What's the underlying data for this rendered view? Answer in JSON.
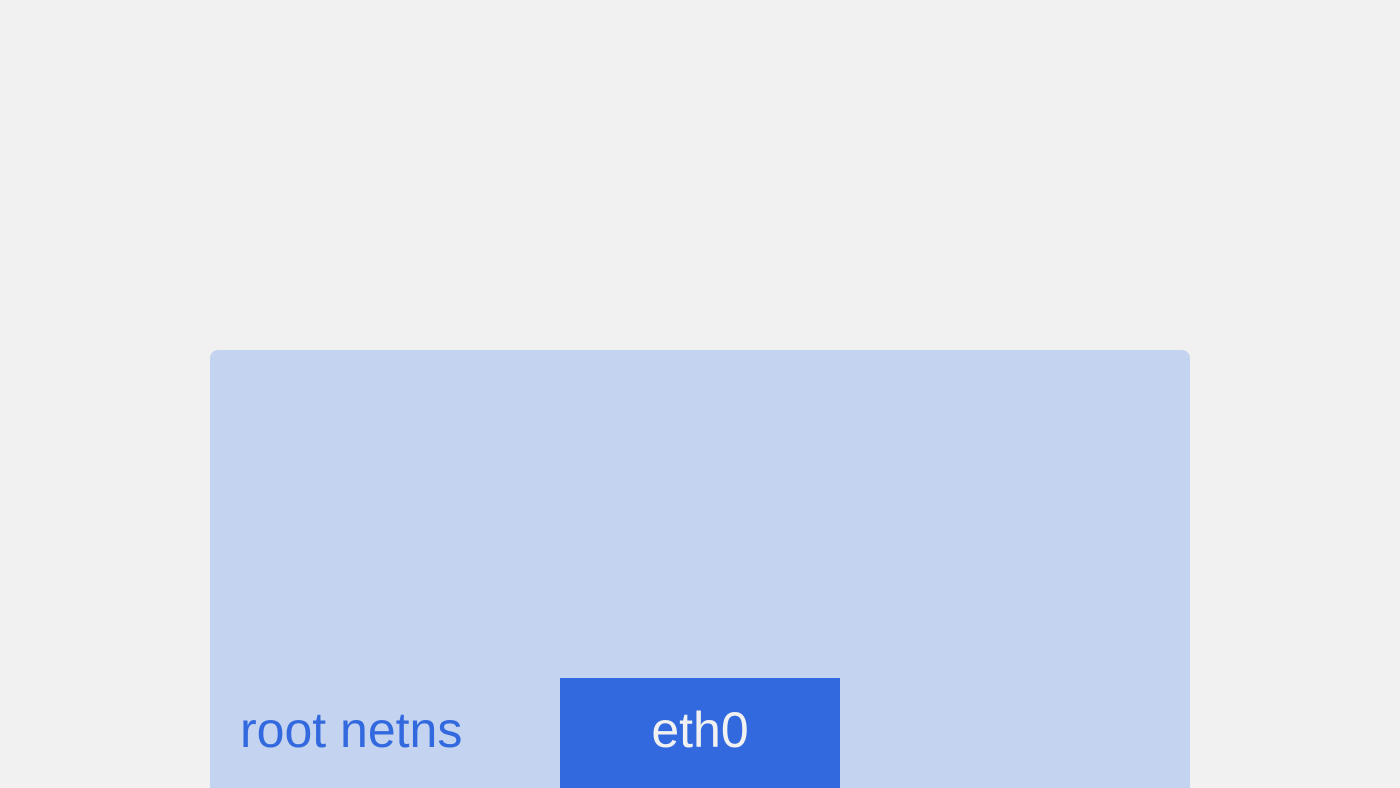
{
  "colors": {
    "background": "#f1f1f1",
    "netns_fill": "#c4d3ef",
    "netns_text": "#3369de",
    "iface_fill": "#3369de",
    "iface_text": "#f1f1f1"
  },
  "diagram": {
    "namespace": {
      "label": "root netns"
    },
    "interfaces": [
      {
        "label": "eth0"
      }
    ]
  }
}
